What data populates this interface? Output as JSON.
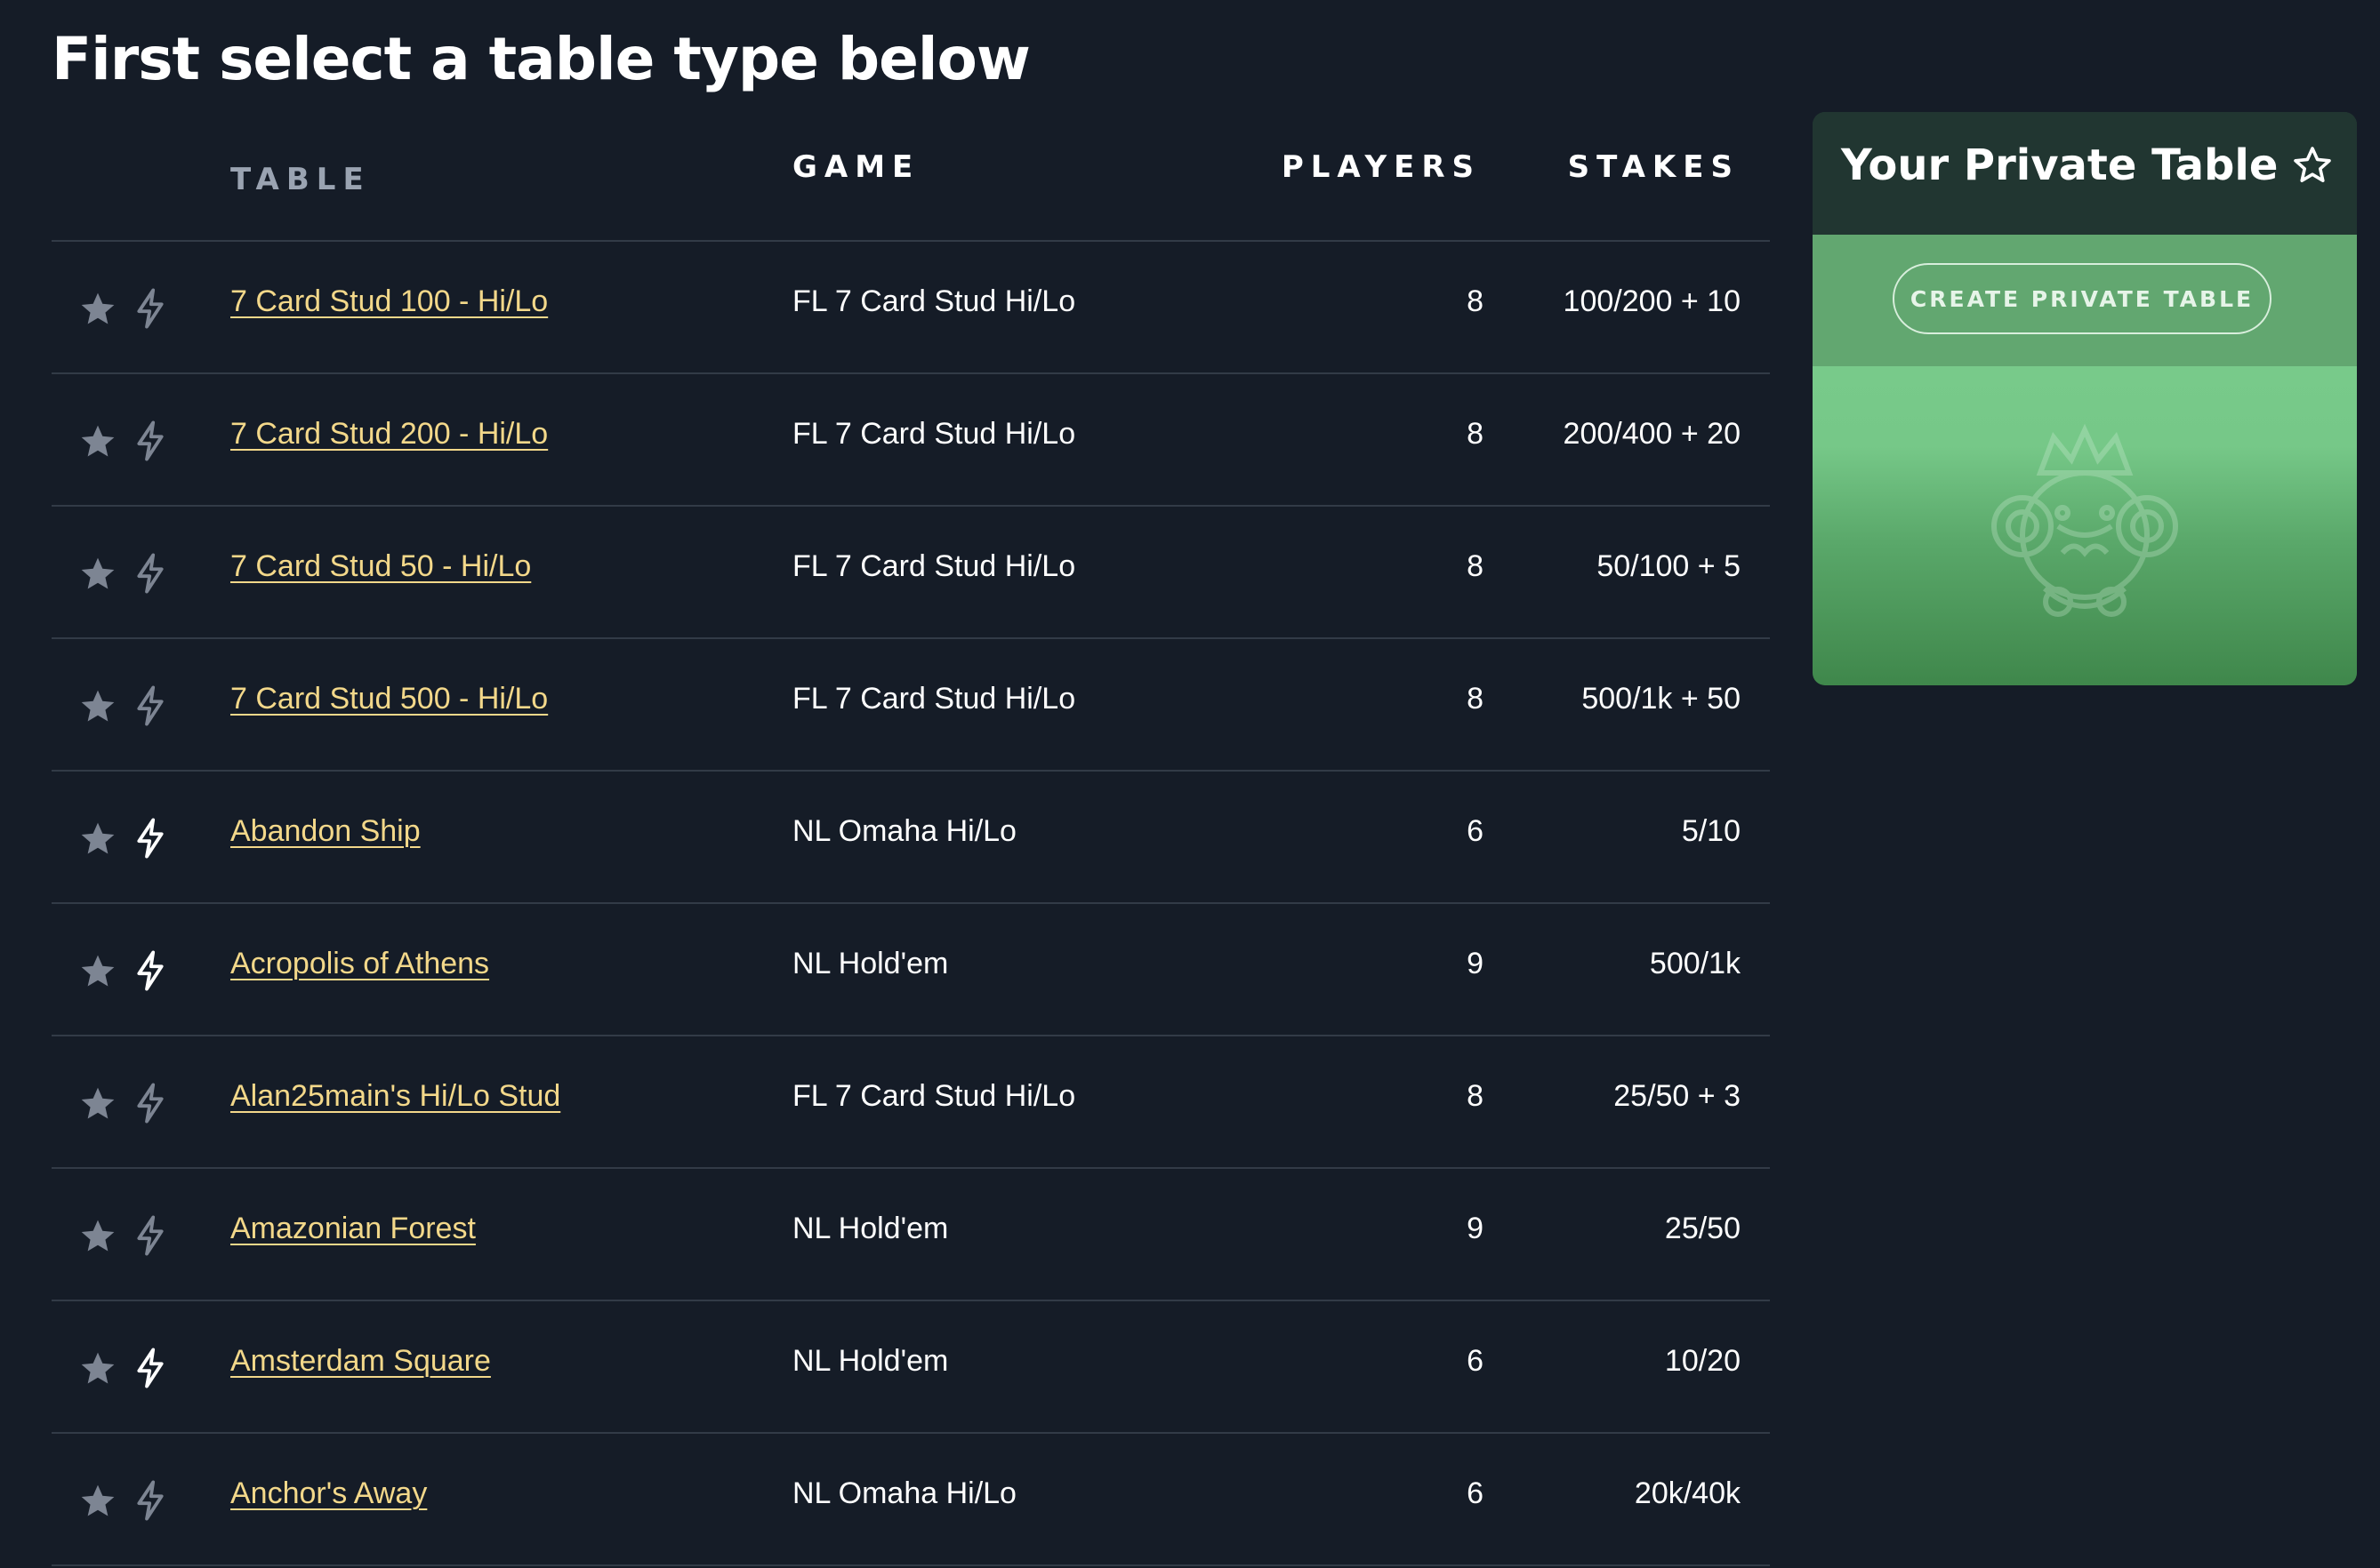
{
  "page": {
    "title": "First select a table type below"
  },
  "table": {
    "headers": {
      "table": "TABLE",
      "game": "GAME",
      "players": "PLAYERS",
      "stakes": "STAKES"
    },
    "rows": [
      {
        "name": "7 Card Stud 100 - Hi/Lo",
        "game": "FL 7 Card Stud Hi/Lo",
        "players": "8",
        "stakes": "100/200 + 10",
        "fast": false
      },
      {
        "name": "7 Card Stud 200 - Hi/Lo",
        "game": "FL 7 Card Stud Hi/Lo",
        "players": "8",
        "stakes": "200/400 + 20",
        "fast": false
      },
      {
        "name": "7 Card Stud 50 - Hi/Lo",
        "game": "FL 7 Card Stud Hi/Lo",
        "players": "8",
        "stakes": "50/100 + 5",
        "fast": false
      },
      {
        "name": "7 Card Stud 500 - Hi/Lo",
        "game": "FL 7 Card Stud Hi/Lo",
        "players": "8",
        "stakes": "500/1k + 50",
        "fast": false
      },
      {
        "name": "Abandon Ship",
        "game": "NL Omaha Hi/Lo",
        "players": "6",
        "stakes": "5/10",
        "fast": true
      },
      {
        "name": "Acropolis of Athens",
        "game": "NL Hold'em",
        "players": "9",
        "stakes": "500/1k",
        "fast": true
      },
      {
        "name": "Alan25main's Hi/Lo Stud",
        "game": "FL 7 Card Stud Hi/Lo",
        "players": "8",
        "stakes": "25/50 + 3",
        "fast": false
      },
      {
        "name": "Amazonian Forest",
        "game": "NL Hold'em",
        "players": "9",
        "stakes": "25/50",
        "fast": false
      },
      {
        "name": "Amsterdam Square",
        "game": "NL Hold'em",
        "players": "6",
        "stakes": "10/20",
        "fast": true
      },
      {
        "name": "Anchor's Away",
        "game": "NL Omaha Hi/Lo",
        "players": "6",
        "stakes": "20k/40k",
        "fast": false
      }
    ]
  },
  "icons": {
    "favorite": "star-icon",
    "fast": "lightning-bolt-icon",
    "card_favorite": "star-outline-icon",
    "mascot": "king-mascot-icon"
  },
  "colors": {
    "background": "#151c27",
    "link": "#f3d88a",
    "muted": "#9aa3b1",
    "card_green": "#62a770",
    "card_dark": "#213631",
    "bolt_active": "#ffffff",
    "bolt_inactive": "#7d8593",
    "star": "#7d8593"
  },
  "private_table": {
    "title": "Your Private Table",
    "button_label": "CREATE PRIVATE TABLE"
  }
}
